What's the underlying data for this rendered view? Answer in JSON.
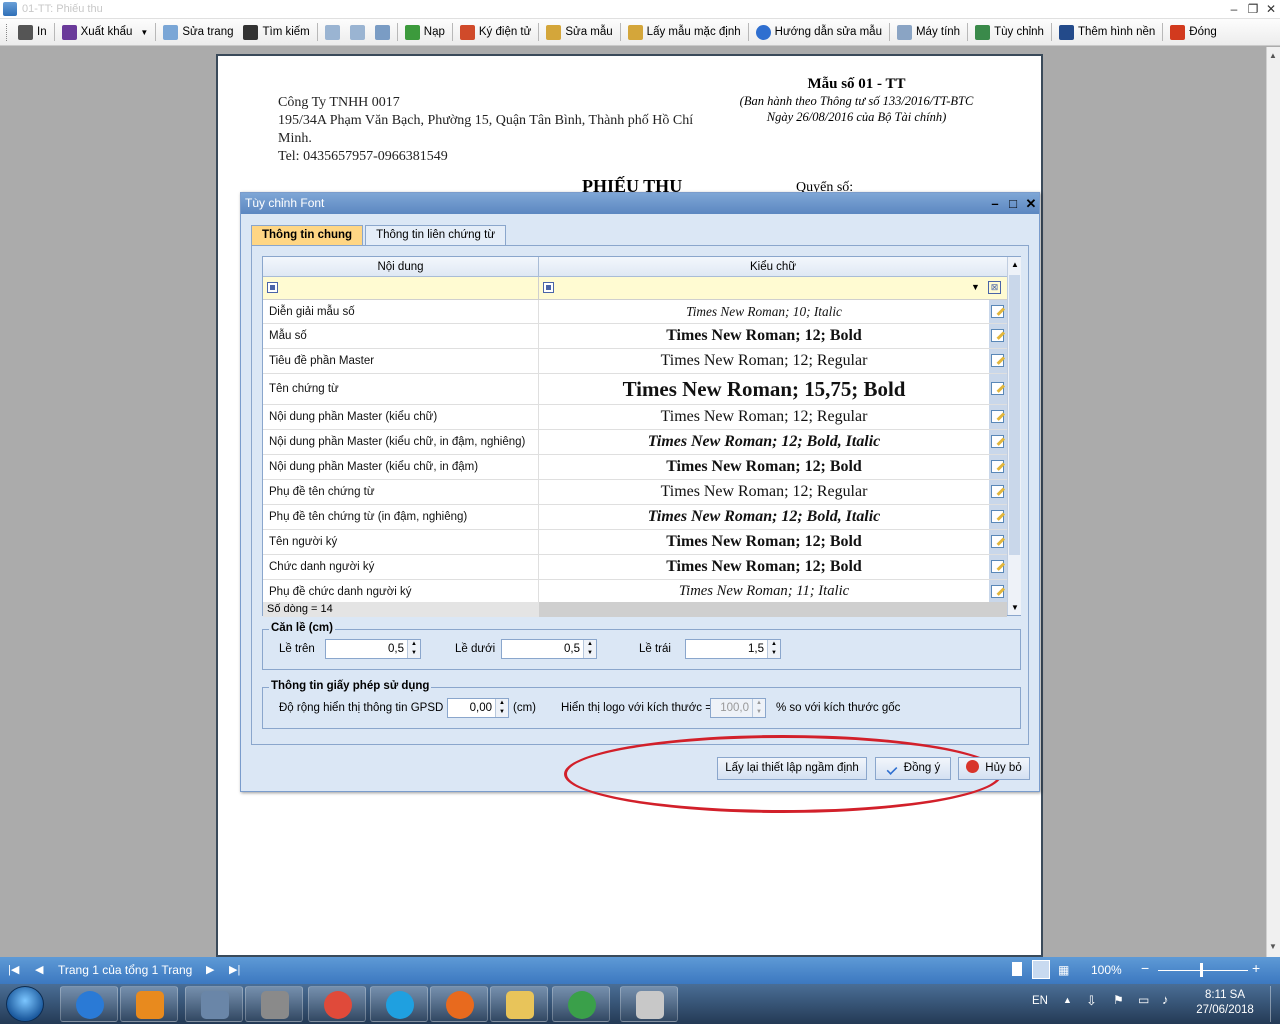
{
  "window": {
    "title": "01-TT: Phiếu thu"
  },
  "toolbar": {
    "items": [
      "In",
      "Xuất khẩu",
      "Sửa trang",
      "Tìm kiếm",
      "Nạp",
      "Ký điện tử",
      "Sửa mẫu",
      "Lấy mẫu mặc định",
      "Hướng dẫn sửa mẫu",
      "Máy tính",
      "Tùy chỉnh",
      "Thêm hình nền",
      "Đóng"
    ]
  },
  "document": {
    "company": "Công Ty TNHH 0017",
    "address": "195/34A Phạm Văn Bạch, Phường 15, Quận Tân Bình, Thành phố Hồ Chí Minh.",
    "phone": "Tel: 0435657957-0966381549",
    "form_no": "Mẫu số 01 - TT",
    "decree_line1": "(Ban hành theo Thông tư số 133/2016/TT-BTC",
    "decree_line2": "Ngày 26/08/2016 của Bộ Tài chính)",
    "doc_title": "PHIẾU THU",
    "book_no": "Quyển số:"
  },
  "dialog": {
    "title": "Tùy chỉnh Font",
    "tabs": [
      "Thông tin chung",
      "Thông tin liên chứng từ"
    ],
    "grid": {
      "col_content": "Nội dung",
      "col_font": "Kiểu chữ",
      "rows": [
        {
          "content": "Diễn giải mẫu số",
          "font": "Times New Roman; 10; Italic"
        },
        {
          "content": "Mẫu số",
          "font": "Times New Roman; 12; Bold"
        },
        {
          "content": "Tiêu đề phần Master",
          "font": "Times New Roman; 12; Regular"
        },
        {
          "content": "Tên chứng từ",
          "font": "Times New Roman; 15,75; Bold"
        },
        {
          "content": "Nội dung phần Master (kiểu chữ)",
          "font": "Times New Roman; 12; Regular"
        },
        {
          "content": "Nội dung phần Master (kiểu chữ, in đậm, nghiêng)",
          "font": "Times New Roman; 12; Bold, Italic"
        },
        {
          "content": "Nội dung phần Master (kiểu chữ, in đậm)",
          "font": "Times New Roman; 12; Bold"
        },
        {
          "content": "Phụ đề tên chứng từ",
          "font": "Times New Roman; 12; Regular"
        },
        {
          "content": "Phụ đề tên chứng từ (in đậm, nghiêng)",
          "font": "Times New Roman; 12; Bold, Italic"
        },
        {
          "content": "Tên người ký",
          "font": "Times New Roman; 12; Bold"
        },
        {
          "content": "Chức danh người ký",
          "font": "Times New Roman; 12; Bold"
        },
        {
          "content": "Phụ đề chức danh người ký",
          "font": "Times New Roman; 11; Italic"
        }
      ],
      "row_count": "Số dòng = 14"
    },
    "margins": {
      "legend": "Căn lề (cm)",
      "top_label": "Lề trên",
      "top_value": "0,5",
      "bottom_label": "Lề dưới",
      "bottom_value": "0,5",
      "left_label": "Lề trái",
      "left_value": "1,5"
    },
    "license": {
      "legend": "Thông tin giấy phép sử dụng",
      "width_label": "Độ rộng hiển thị thông tin GPSD",
      "width_value": "0,00",
      "width_unit": "(cm)",
      "logo_label": "Hiển thị logo với kích thước =",
      "logo_value": "100,0",
      "logo_suffix": "% so với kích thước gốc"
    },
    "buttons": {
      "reset": "Lấy lại thiết lập ngầm định",
      "ok": "Đồng ý",
      "cancel": "Hủy bỏ"
    }
  },
  "statusbar": {
    "page_info": "Trang 1 của tổng 1 Trang",
    "zoom": "100%"
  },
  "taskbar": {
    "lang": "EN",
    "time": "8:11 SA",
    "date": "27/06/2018"
  },
  "colors": {
    "accent": "#3c78c0",
    "tab_active": "#ffd684",
    "highlight": "#d2202a"
  }
}
